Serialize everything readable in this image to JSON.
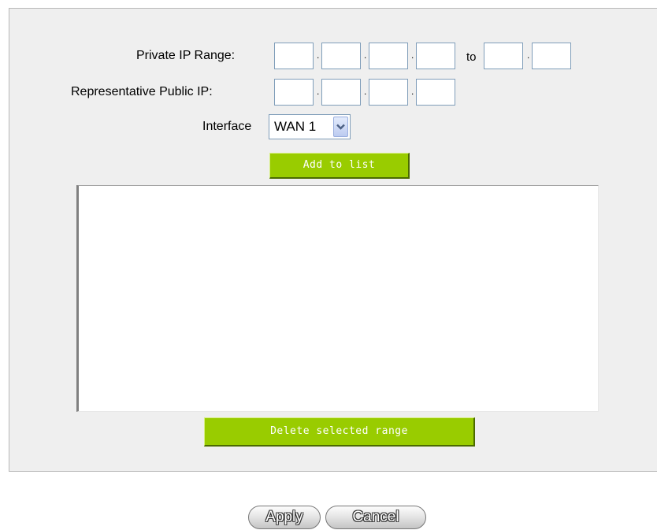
{
  "form": {
    "private_range_label": "Private IP Range:",
    "to_label": "to",
    "public_ip_label": "Representative Public IP:",
    "interface_label": "Interface",
    "interface_selected": "WAN 1",
    "ip_separator": "."
  },
  "buttons": {
    "add_to_list": "Add to list",
    "delete_selected": "Delete selected range",
    "apply": "Apply",
    "cancel": "Cancel"
  },
  "colors": {
    "panel_bg": "#efefef",
    "green_button": "#99cc00"
  },
  "icons": {
    "dropdown": "chevron-down-icon"
  }
}
